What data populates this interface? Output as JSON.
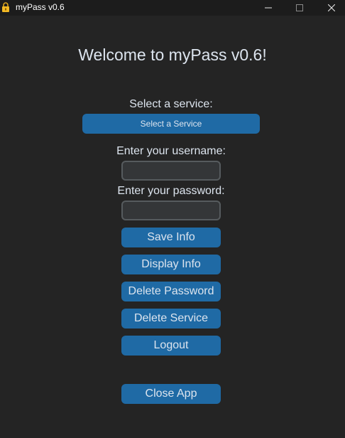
{
  "window": {
    "title": "myPass v0.6",
    "icon": "lock-icon",
    "controls": {
      "minimize": "─",
      "maximize": "☐",
      "close": "✕"
    }
  },
  "main": {
    "heading": "Welcome to myPass v0.6!",
    "service_label": "Select a service:",
    "service_button": "Select a Service",
    "username_label": "Enter your username:",
    "username_value": "",
    "password_label": "Enter your password:",
    "password_value": ""
  },
  "buttons": {
    "save": "Save Info",
    "display": "Display Info",
    "delete_password": "Delete Password",
    "delete_service": "Delete Service",
    "logout": "Logout",
    "close_app": "Close App"
  },
  "colors": {
    "background": "#242424",
    "titlebar": "#1c1c1c",
    "button": "#1f6aa5",
    "entry_bg": "#343638",
    "entry_border": "#565b5e",
    "text": "#dce4ee"
  }
}
